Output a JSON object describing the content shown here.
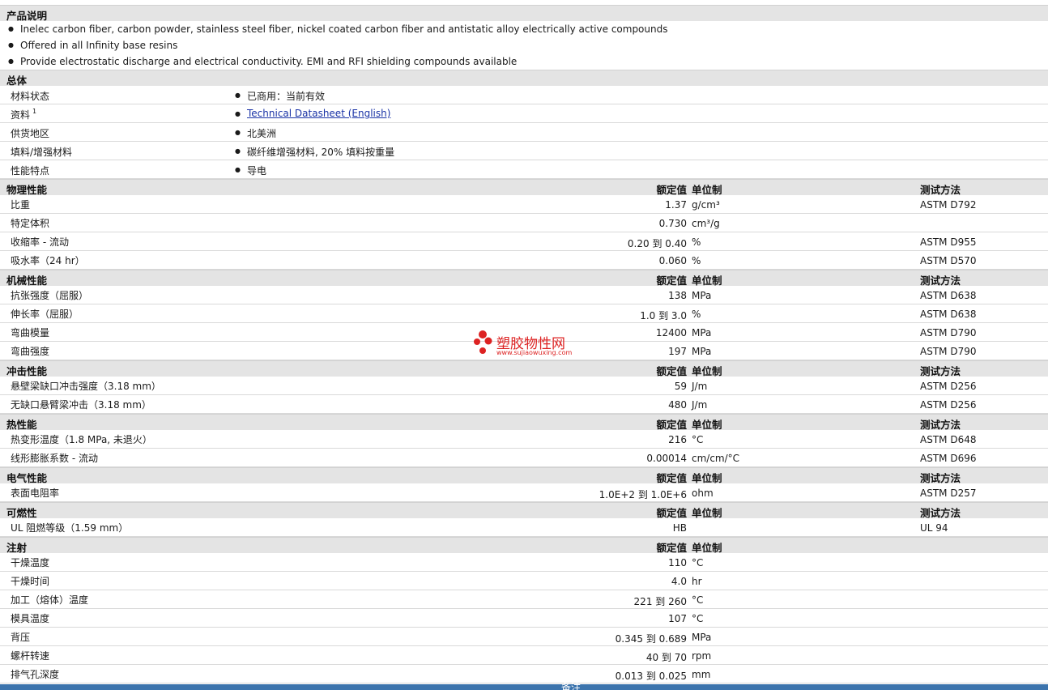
{
  "product_description": {
    "title": "产品说明",
    "bullets": [
      "Inelec carbon fiber, carbon powder, stainless steel fiber, nickel coated carbon fiber and antistatic alloy electrically active compounds",
      "Offered in all Infinity base resins",
      "Provide electrostatic discharge and electrical conductivity. EMI and RFI shielding compounds available"
    ]
  },
  "general": {
    "title": "总体",
    "rows": [
      {
        "label": "材料状态",
        "sup": "",
        "value": "已商用：当前有效",
        "link": false
      },
      {
        "label": "资料",
        "sup": "1",
        "value": "Technical Datasheet (English)",
        "link": true
      },
      {
        "label": "供货地区",
        "sup": "",
        "value": "北美洲",
        "link": false
      },
      {
        "label": "填料/增强材料",
        "sup": "",
        "value": "碳纤维增强材料, 20% 填料按重量",
        "link": false
      },
      {
        "label": "性能特点",
        "sup": "",
        "value": "导电",
        "link": false
      }
    ]
  },
  "col_headers": {
    "value": "额定值",
    "unit": "单位制",
    "method": "测试方法"
  },
  "sections": [
    {
      "title": "物理性能",
      "show_method": true,
      "rows": [
        {
          "label": "比重",
          "value": "1.37",
          "unit": "g/cm³",
          "method": "ASTM D792"
        },
        {
          "label": "特定体积",
          "value": "0.730",
          "unit": "cm³/g",
          "method": ""
        },
        {
          "label": "收缩率 - 流动",
          "value": "0.20 到  0.40",
          "unit": "%",
          "method": "ASTM D955"
        },
        {
          "label": "吸水率（24 hr）",
          "value": "0.060",
          "unit": "%",
          "method": "ASTM D570"
        }
      ]
    },
    {
      "title": "机械性能",
      "show_method": true,
      "rows": [
        {
          "label": "抗张强度（屈服）",
          "value": "138",
          "unit": "MPa",
          "method": "ASTM D638"
        },
        {
          "label": "伸长率（屈服）",
          "value": "1.0 到  3.0",
          "unit": "%",
          "method": "ASTM D638"
        },
        {
          "label": "弯曲模量",
          "value": "12400",
          "unit": "MPa",
          "method": "ASTM D790"
        },
        {
          "label": "弯曲强度",
          "value": "197",
          "unit": "MPa",
          "method": "ASTM D790"
        }
      ]
    },
    {
      "title": "冲击性能",
      "show_method": true,
      "rows": [
        {
          "label": "悬壁梁缺口冲击强度（3.18 mm）",
          "value": "59",
          "unit": "J/m",
          "method": "ASTM D256"
        },
        {
          "label": "无缺口悬臂梁冲击（3.18 mm）",
          "value": "480",
          "unit": "J/m",
          "method": "ASTM D256"
        }
      ]
    },
    {
      "title": "热性能",
      "show_method": true,
      "rows": [
        {
          "label": "热变形温度（1.8 MPa, 未退火）",
          "value": "216",
          "unit": "°C",
          "method": "ASTM D648"
        },
        {
          "label": "线形膨胀系数 - 流动",
          "value": "0.00014",
          "unit": "cm/cm/°C",
          "method": "ASTM D696"
        }
      ]
    },
    {
      "title": "电气性能",
      "show_method": true,
      "rows": [
        {
          "label": "表面电阻率",
          "value": "1.0E+2 到  1.0E+6",
          "unit": "ohm",
          "method": "ASTM D257"
        }
      ]
    },
    {
      "title": "可燃性",
      "show_method": true,
      "rows": [
        {
          "label": "UL 阻燃等级（1.59 mm）",
          "value": "HB",
          "unit": "",
          "method": "UL 94"
        }
      ]
    },
    {
      "title": "注射",
      "show_method": false,
      "rows": [
        {
          "label": "干燥温度",
          "value": "110",
          "unit": "°C",
          "method": ""
        },
        {
          "label": "干燥时间",
          "value": "4.0",
          "unit": "hr",
          "method": ""
        },
        {
          "label": "加工（熔体）温度",
          "value": "221 到  260",
          "unit": "°C",
          "method": ""
        },
        {
          "label": "模具温度",
          "value": "107",
          "unit": "°C",
          "method": ""
        },
        {
          "label": "背压",
          "value": "0.345 到  0.689",
          "unit": "MPa",
          "method": ""
        },
        {
          "label": "螺杆转速",
          "value": "40 到  70",
          "unit": "rpm",
          "method": ""
        },
        {
          "label": "排气孔深度",
          "value": "0.013 到  0.025",
          "unit": "mm",
          "method": ""
        }
      ]
    }
  ],
  "footer": {
    "label": "备注"
  },
  "watermark": {
    "title": "塑胶物性网",
    "url": "www.sujiaowuxing.com",
    "color": "#dd2222"
  },
  "colors": {
    "header_bg": "#e4e4e4",
    "link": "#1a33a6",
    "footer_bar": "#3c74ad"
  }
}
